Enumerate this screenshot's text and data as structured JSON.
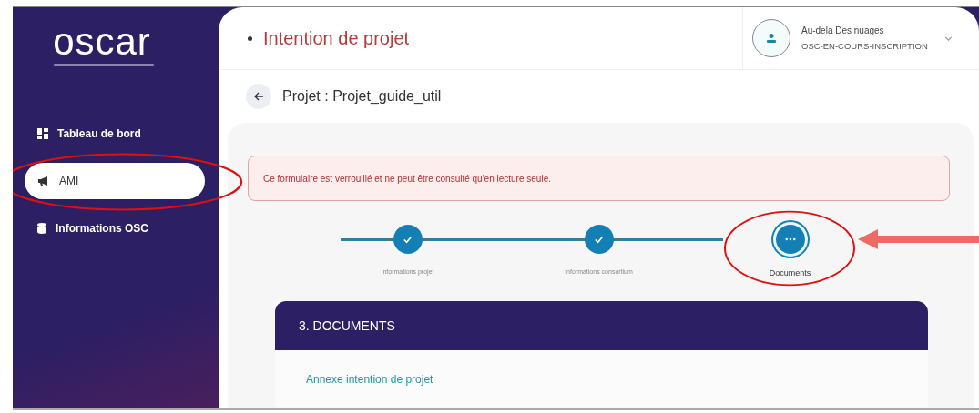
{
  "sidebar": {
    "logo": "oscar",
    "items": [
      {
        "label": "Tableau de bord",
        "selected": false,
        "circled": false
      },
      {
        "label": "AMI",
        "selected": true,
        "circled": true
      },
      {
        "label": "Informations OSC",
        "selected": false,
        "circled": false
      }
    ]
  },
  "header": {
    "title": "Intention de projet",
    "user": {
      "name": "Au-dela Des nuages",
      "status": "OSC-EN-COURS-INSCRIPTION"
    }
  },
  "breadcrumb": {
    "label": "Projet : Projet_guide_util"
  },
  "alert": {
    "message": "Ce formulaire est verrouillé et ne peut être consulté qu'en lecture seule."
  },
  "stepper": {
    "steps": [
      {
        "label": "Informations projet",
        "done": true,
        "circled": false,
        "arrow": false
      },
      {
        "label": "Informations consortium",
        "done": true,
        "circled": false,
        "arrow": false
      },
      {
        "label": "Documents",
        "done": false,
        "circled": true,
        "arrow": true
      }
    ]
  },
  "section": {
    "title": "3. DOCUMENTS",
    "links": [
      "Annexe intention de projet"
    ]
  }
}
